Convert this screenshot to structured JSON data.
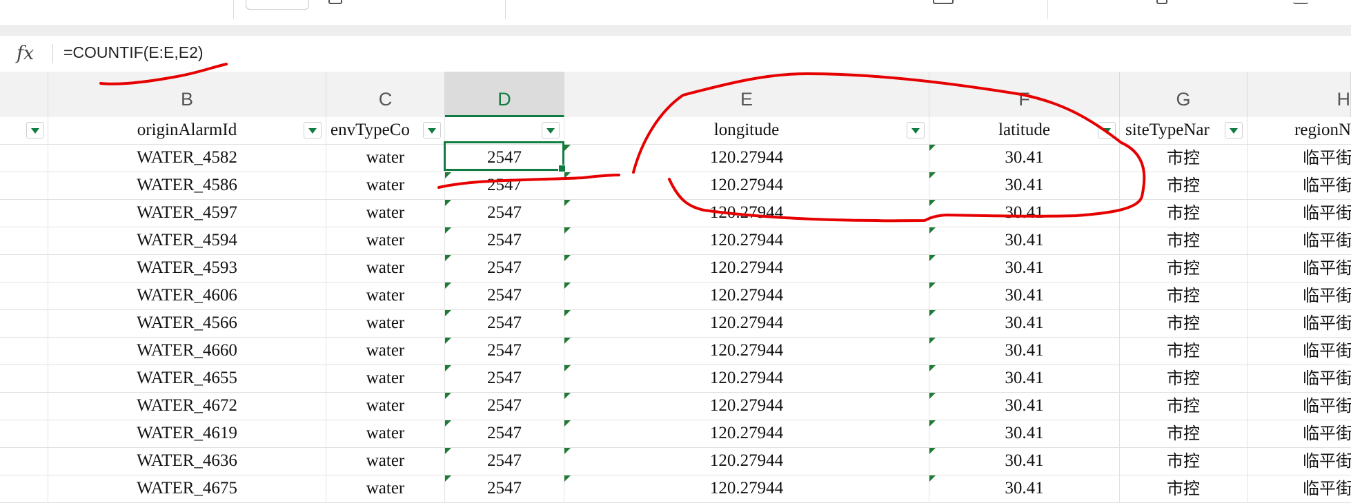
{
  "formula_bar": {
    "fx_label": "fx",
    "formula": "=COUNTIF(E:E,E2)"
  },
  "columns": [
    {
      "letter": "B",
      "header": "originAlarmId"
    },
    {
      "letter": "C",
      "header": "envTypeCo"
    },
    {
      "letter": "D",
      "header": ""
    },
    {
      "letter": "E",
      "header": "longitude"
    },
    {
      "letter": "F",
      "header": "latitude"
    },
    {
      "letter": "G",
      "header": "siteTypeNar"
    },
    {
      "letter": "H",
      "header": "regionN"
    }
  ],
  "active_cell": {
    "column": "D",
    "value": "2547"
  },
  "rows": [
    {
      "b": "WATER_4582",
      "c": "water",
      "d": "2547",
      "e": "120.27944",
      "f": "30.41",
      "g": "市控",
      "h": "临平街"
    },
    {
      "b": "WATER_4586",
      "c": "water",
      "d": "2547",
      "e": "120.27944",
      "f": "30.41",
      "g": "市控",
      "h": "临平街"
    },
    {
      "b": "WATER_4597",
      "c": "water",
      "d": "2547",
      "e": "120.27944",
      "f": "30.41",
      "g": "市控",
      "h": "临平街"
    },
    {
      "b": "WATER_4594",
      "c": "water",
      "d": "2547",
      "e": "120.27944",
      "f": "30.41",
      "g": "市控",
      "h": "临平街"
    },
    {
      "b": "WATER_4593",
      "c": "water",
      "d": "2547",
      "e": "120.27944",
      "f": "30.41",
      "g": "市控",
      "h": "临平街"
    },
    {
      "b": "WATER_4606",
      "c": "water",
      "d": "2547",
      "e": "120.27944",
      "f": "30.41",
      "g": "市控",
      "h": "临平街"
    },
    {
      "b": "WATER_4566",
      "c": "water",
      "d": "2547",
      "e": "120.27944",
      "f": "30.41",
      "g": "市控",
      "h": "临平街"
    },
    {
      "b": "WATER_4660",
      "c": "water",
      "d": "2547",
      "e": "120.27944",
      "f": "30.41",
      "g": "市控",
      "h": "临平街"
    },
    {
      "b": "WATER_4655",
      "c": "water",
      "d": "2547",
      "e": "120.27944",
      "f": "30.41",
      "g": "市控",
      "h": "临平街"
    },
    {
      "b": "WATER_4672",
      "c": "water",
      "d": "2547",
      "e": "120.27944",
      "f": "30.41",
      "g": "市控",
      "h": "临平街"
    },
    {
      "b": "WATER_4619",
      "c": "water",
      "d": "2547",
      "e": "120.27944",
      "f": "30.41",
      "g": "市控",
      "h": "临平街"
    },
    {
      "b": "WATER_4636",
      "c": "water",
      "d": "2547",
      "e": "120.27944",
      "f": "30.41",
      "g": "市控",
      "h": "临平街"
    },
    {
      "b": "WATER_4675",
      "c": "water",
      "d": "2547",
      "e": "120.27944",
      "f": "30.41",
      "g": "市控",
      "h": "临平街"
    }
  ],
  "colors": {
    "accent": "#107c41",
    "annotation": "#e60000"
  }
}
